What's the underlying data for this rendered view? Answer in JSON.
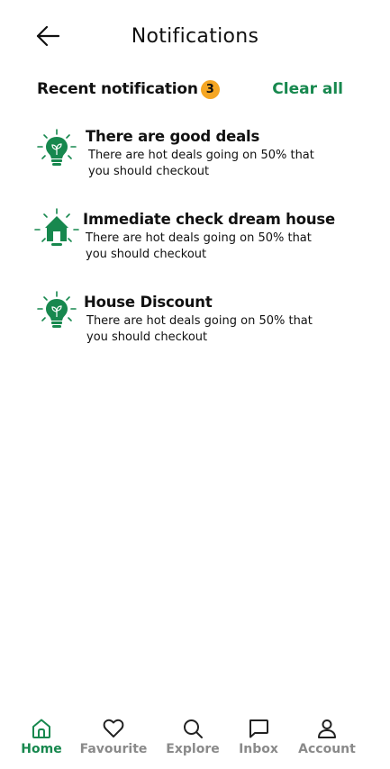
{
  "header": {
    "title": "Notifications",
    "back_icon": "arrow-left-icon"
  },
  "section": {
    "title": "Recent notification",
    "badge_count": "3",
    "clear_label": "Clear all"
  },
  "notifications": [
    {
      "icon": "bulb-icon",
      "title": "There are good deals",
      "body": "There are hot deals going on 50% that you should checkout"
    },
    {
      "icon": "house-icon",
      "title": "Immediate check dream house",
      "body": "There are hot deals going on 50% that you should checkout"
    },
    {
      "icon": "bulb-icon",
      "title": "House Discount",
      "body": "There are hot deals going on 50% that you should checkout"
    }
  ],
  "bottom_nav": {
    "active": "Home",
    "items": [
      {
        "label": "Home",
        "icon": "home-icon"
      },
      {
        "label": "Favourite",
        "icon": "heart-icon"
      },
      {
        "label": "Explore",
        "icon": "search-icon"
      },
      {
        "label": "Inbox",
        "icon": "message-icon"
      },
      {
        "label": "Account",
        "icon": "user-icon"
      }
    ]
  },
  "colors": {
    "accent": "#17884e",
    "badge": "#f5a623",
    "inactive": "#8a8a8a"
  }
}
